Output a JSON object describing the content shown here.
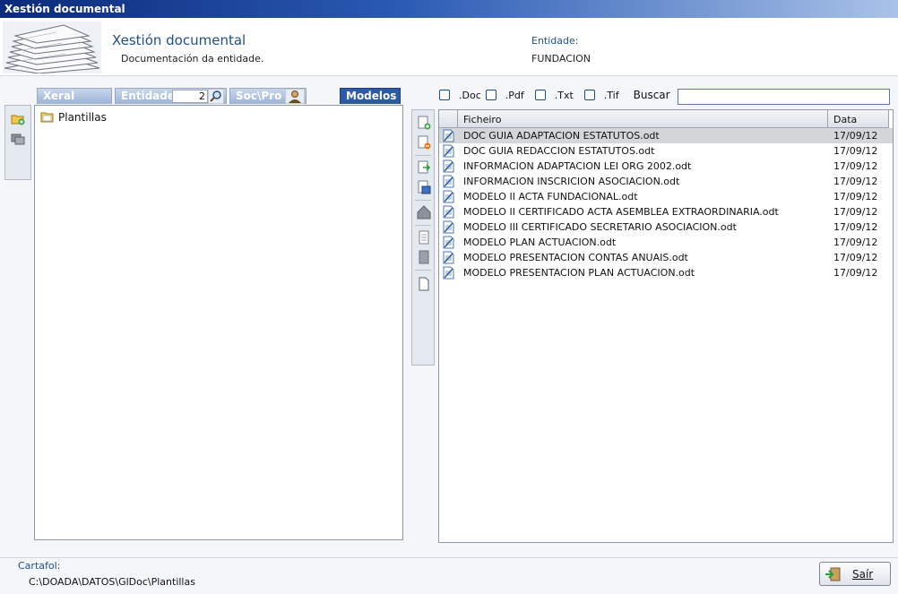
{
  "window": {
    "title": "Xestión documental"
  },
  "header": {
    "title": "Xestión documental",
    "subtitle": "Documentación da entidade.",
    "entity_label": "Entidade:",
    "entity_value": "FUNDACION"
  },
  "tabs": {
    "xeral": "Xeral",
    "entidade": "Entidade",
    "entidade_value": "2",
    "socpro": "Soc\\Pro",
    "modelos": "Modelos"
  },
  "tree": {
    "items": [
      {
        "label": "Plantillas",
        "icon": "folder-icon"
      }
    ]
  },
  "filters": {
    "doc": ".Doc",
    "pdf": ".Pdf",
    "txt": ".Txt",
    "tif": ".Tif",
    "search_label": "Buscar",
    "search_value": ""
  },
  "table": {
    "columns": {
      "file": "Ficheiro",
      "date": "Data"
    },
    "rows": [
      {
        "file": "DOC GUIA ADAPTACION ESTATUTOS.odt",
        "date": "17/09/12"
      },
      {
        "file": "DOC GUIA REDACCION ESTATUTOS.odt",
        "date": "17/09/12"
      },
      {
        "file": "INFORMACION ADAPTACION LEI ORG 2002.odt",
        "date": "17/09/12"
      },
      {
        "file": "INFORMACION INSCRICION ASOCIACION.odt",
        "date": "17/09/12"
      },
      {
        "file": "MODELO II ACTA FUNDACIONAL.odt",
        "date": "17/09/12"
      },
      {
        "file": "MODELO II CERTIFICADO ACTA ASEMBLEA EXTRAORDINARIA.odt",
        "date": "17/09/12"
      },
      {
        "file": "MODELO III CERTIFICADO SECRETARIO ASOCIACION.odt",
        "date": "17/09/12"
      },
      {
        "file": "MODELO PLAN ACTUACION.odt",
        "date": "17/09/12"
      },
      {
        "file": "MODELO PRESENTACION CONTAS ANUAIS.odt",
        "date": "17/09/12"
      },
      {
        "file": "MODELO PRESENTACION PLAN ACTUACION.odt",
        "date": "17/09/12"
      }
    ],
    "selected_index": 0
  },
  "footer": {
    "folder_label": "Cartafol:",
    "folder_path": "C:\\DOADA\\DATOS\\GlDoc\\Plantillas",
    "exit_label": "Saír"
  },
  "colors": {
    "accent": "#2d5aa8",
    "title_text": "#1f4e8a",
    "selected_row": "#d4d6da"
  }
}
